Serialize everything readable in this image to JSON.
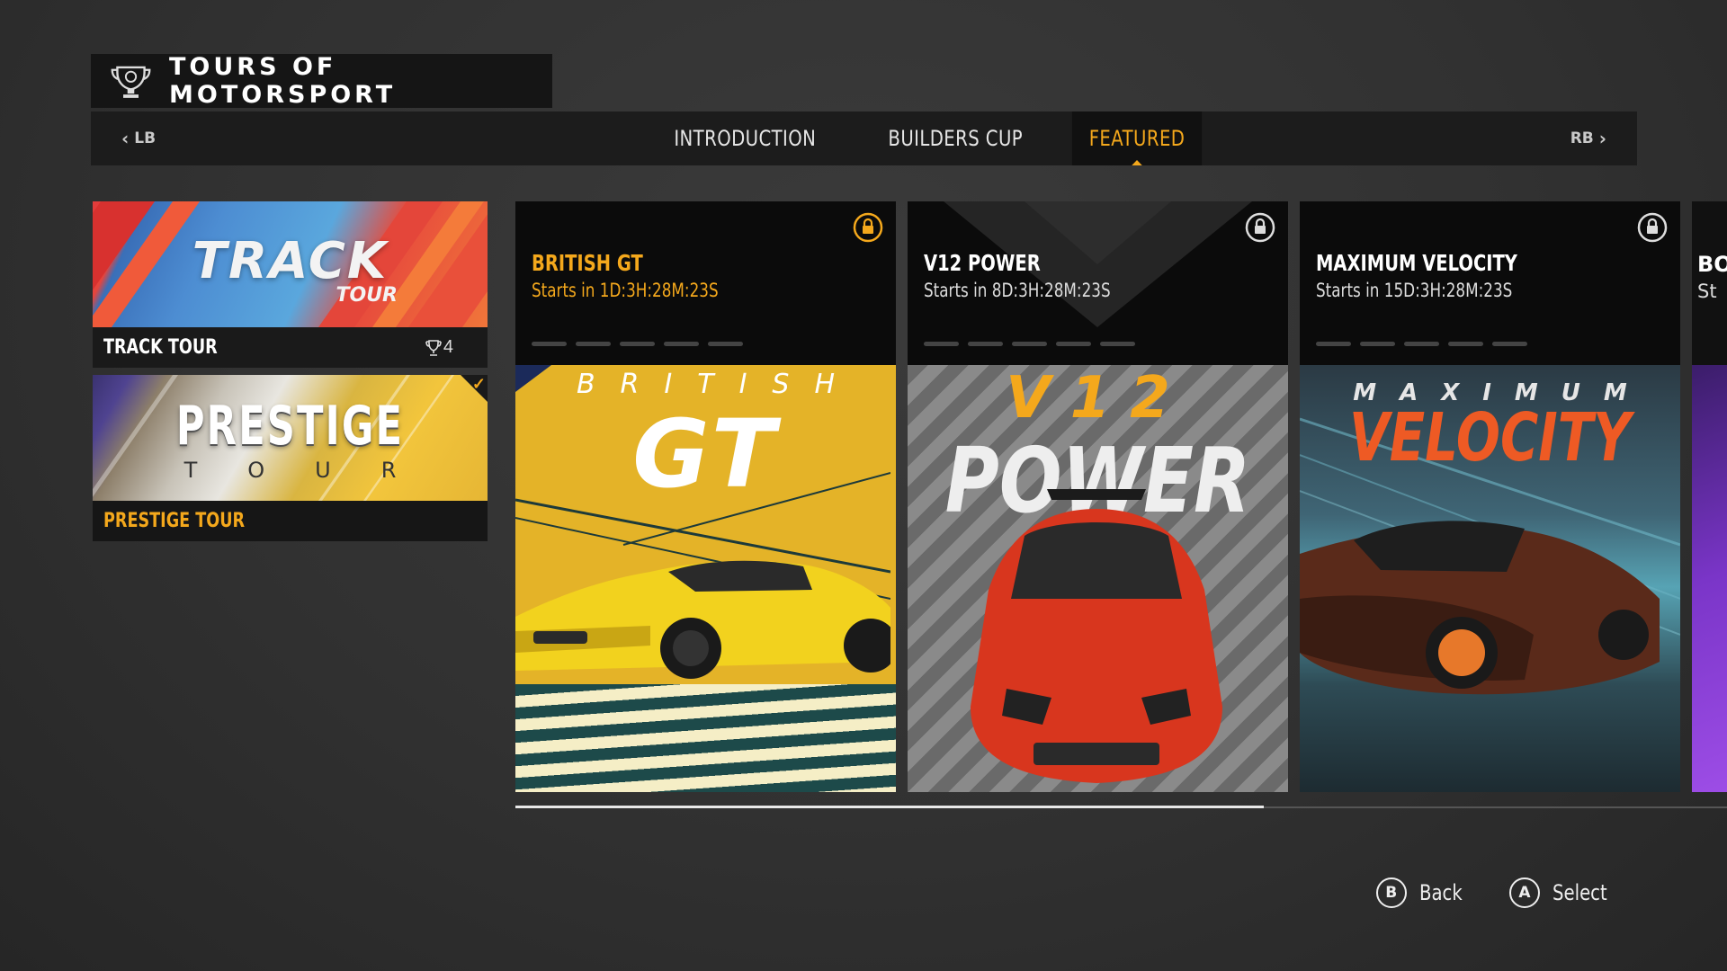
{
  "header": {
    "title": "TOURS OF MOTORSPORT",
    "icon": "trophy-emblem-icon"
  },
  "tabbar": {
    "left_hint": "LB",
    "right_hint": "RB",
    "tabs": [
      {
        "label": "INTRODUCTION",
        "active": false
      },
      {
        "label": "BUILDERS CUP",
        "active": false
      },
      {
        "label": "FEATURED",
        "active": true
      }
    ]
  },
  "tours": [
    {
      "label": "TRACK TOUR",
      "art_title": "TRACK",
      "art_subtitle": "TOUR",
      "trophy_count": "4"
    },
    {
      "label": "PRESTIGE TOUR",
      "art_title": "PRESTIGE",
      "art_subtitle": "TOUR",
      "completed": true
    }
  ],
  "events": [
    {
      "name": "BRITISH GT",
      "starts": "Starts in 1D:3H:28M:23S",
      "locked": true,
      "selected": true,
      "art_top": "BRITISH",
      "art_main": "GT"
    },
    {
      "name": "V12 POWER",
      "starts": "Starts in 8D:3H:28M:23S",
      "locked": true,
      "selected": false,
      "art_top": "V12",
      "art_main": "POWER"
    },
    {
      "name": "MAXIMUM VELOCITY",
      "starts": "Starts in 15D:3H:28M:23S",
      "locked": true,
      "selected": false,
      "art_top": "MAXIMUM",
      "art_main": "VELOCITY"
    },
    {
      "name": "BO",
      "starts": "St"
    }
  ],
  "footer": {
    "back": {
      "button": "B",
      "label": "Back"
    },
    "select": {
      "button": "A",
      "label": "Select"
    }
  },
  "colors": {
    "accent": "#f4a81c",
    "background": "#333333"
  }
}
